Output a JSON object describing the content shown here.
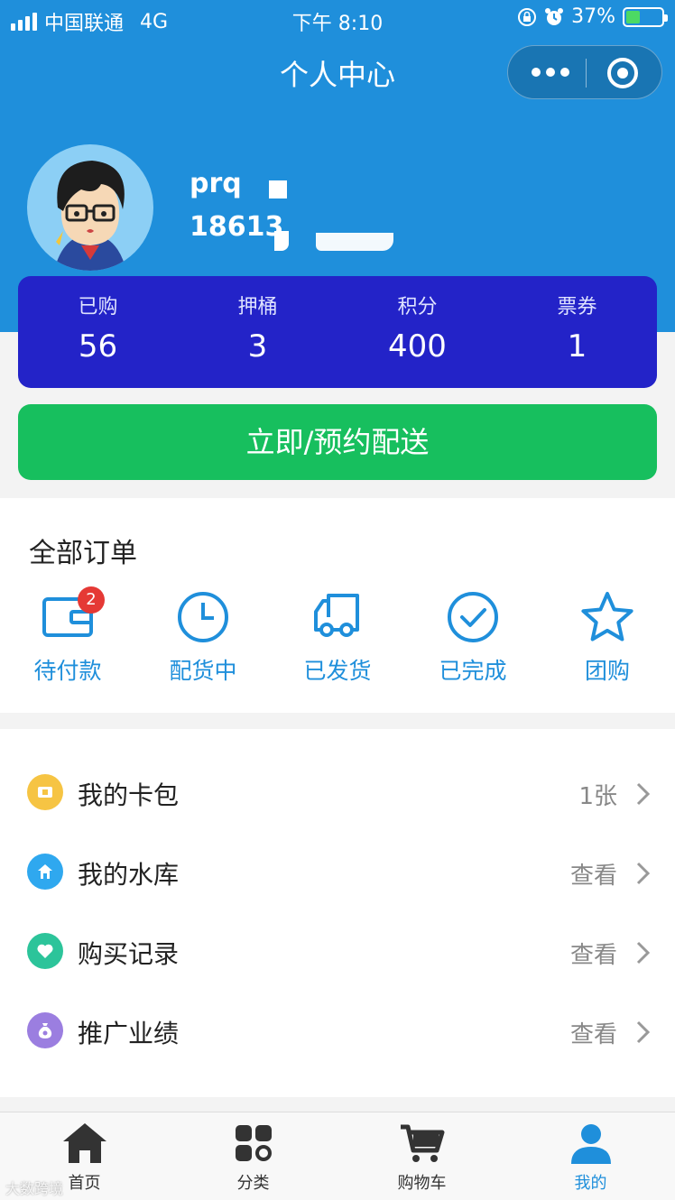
{
  "status_bar": {
    "carrier": "中国联通",
    "network": "4G",
    "time": "下午 8:10",
    "battery": "37%"
  },
  "nav": {
    "title": "个人中心"
  },
  "profile": {
    "username": "prq",
    "phone": "18613"
  },
  "stats": [
    {
      "label": "已购",
      "value": "56"
    },
    {
      "label": "押桶",
      "value": "3"
    },
    {
      "label": "积分",
      "value": "400"
    },
    {
      "label": "票券",
      "value": "1"
    }
  ],
  "deliver_button": "立即/预约配送",
  "orders": {
    "title": "全部订单",
    "items": [
      {
        "label": "待付款",
        "icon": "wallet-icon",
        "badge": "2"
      },
      {
        "label": "配货中",
        "icon": "clock-icon"
      },
      {
        "label": "已发货",
        "icon": "truck-icon"
      },
      {
        "label": "已完成",
        "icon": "check-circle-icon"
      },
      {
        "label": "团购",
        "icon": "star-icon"
      }
    ]
  },
  "menu": [
    {
      "label": "我的卡包",
      "value": "1张",
      "icon": "ticket-icon",
      "color": "#f6c443"
    },
    {
      "label": "我的水库",
      "value": "查看",
      "icon": "home-icon",
      "color": "#2fa8ef"
    },
    {
      "label": "购买记录",
      "value": "查看",
      "icon": "heart-icon",
      "color": "#2cc49a"
    },
    {
      "label": "推广业绩",
      "value": "查看",
      "icon": "money-bag-icon",
      "color": "#9b7ee0"
    }
  ],
  "tabs": [
    {
      "label": "首页",
      "icon": "home-icon"
    },
    {
      "label": "分类",
      "icon": "category-icon"
    },
    {
      "label": "购物车",
      "icon": "cart-icon"
    },
    {
      "label": "我的",
      "icon": "user-icon",
      "active": true
    }
  ],
  "colors": {
    "primary": "#1f8fdb",
    "stats_bg": "#2323c8",
    "deliver_green": "#17bf5e",
    "badge_red": "#e53935"
  },
  "watermark": "大数跨境"
}
